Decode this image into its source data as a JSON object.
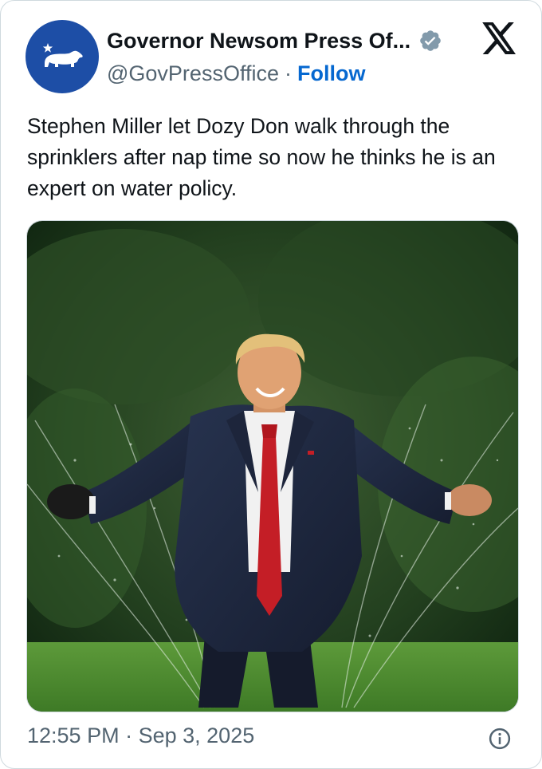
{
  "author": {
    "display_name": "Governor Newsom Press Of...",
    "handle": "@GovPressOffice",
    "separator": "·",
    "follow_label": "Follow",
    "avatar_icon": "california-bear-star-icon",
    "verified_icon": "verified-badge-icon"
  },
  "platform": {
    "logo_icon": "x-logo-icon"
  },
  "tweet": {
    "text": "Stephen Miller let Dozy Don walk through the sprinklers after nap time so now he thinks he is an expert on water policy."
  },
  "media": {
    "kind": "photo",
    "icon": "photo-man-in-suit-walking-through-sprinklers"
  },
  "footer": {
    "time": "12:55 PM",
    "separator": "·",
    "date": "Sep 3, 2025",
    "info_icon": "info-icon"
  },
  "colors": {
    "text_primary": "#0f1419",
    "text_secondary": "#536471",
    "follow_link": "#0668d0",
    "avatar_bg": "#1d4ea6",
    "verified_badge": "#829aab",
    "border": "#cfd9de"
  }
}
